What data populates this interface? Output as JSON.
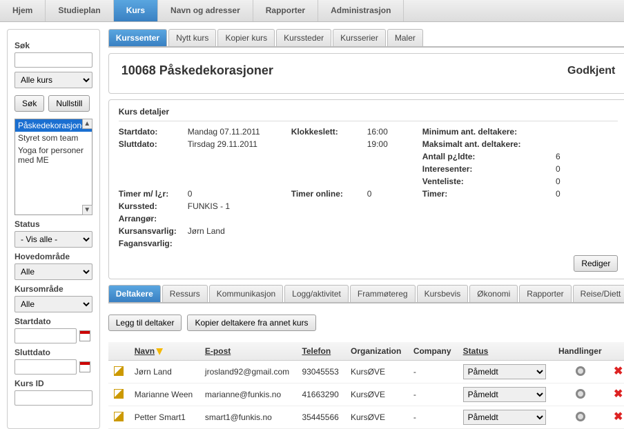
{
  "topnav": {
    "items": [
      {
        "label": "Hjem"
      },
      {
        "label": "Studieplan"
      },
      {
        "label": "Kurs"
      },
      {
        "label": "Navn og adresser"
      },
      {
        "label": "Rapporter"
      },
      {
        "label": "Administrasjon"
      }
    ],
    "active_index": 2
  },
  "sidebar": {
    "search_label": "Søk",
    "search_value": "",
    "scope_select": "Alle kurs",
    "search_btn": "Søk",
    "reset_btn": "Nullstill",
    "courses": [
      {
        "label": "Påskedekorasjoner",
        "selected": true
      },
      {
        "label": "Styret som team",
        "selected": false
      },
      {
        "label": "Yoga for personer med ME",
        "selected": false
      }
    ],
    "status_label": "Status",
    "status_value": "- Vis alle -",
    "main_area_label": "Hovedområde",
    "main_area_value": "Alle",
    "course_area_label": "Kursområde",
    "course_area_value": "Alle",
    "start_date_label": "Startdato",
    "start_date_value": "",
    "end_date_label": "Sluttdato",
    "end_date_value": "",
    "course_id_label": "Kurs ID",
    "course_id_value": ""
  },
  "subtabs_top": {
    "items": [
      {
        "label": "Kurssenter"
      },
      {
        "label": "Nytt kurs"
      },
      {
        "label": "Kopier kurs"
      },
      {
        "label": "Kurssteder"
      },
      {
        "label": "Kursserier"
      },
      {
        "label": "Maler"
      }
    ],
    "active_index": 0
  },
  "header": {
    "title": "10068 Påskedekorasjoner",
    "status": "Godkjent"
  },
  "details": {
    "panel_title": "Kurs detaljer",
    "start_label": "Startdato:",
    "start_value": "Mandag 07.11.2011",
    "end_label": "Sluttdato:",
    "end_value": "Tirsdag 29.11.2011",
    "clock_label": "Klokkeslett:",
    "clock_start": "16:00",
    "clock_end": "19:00",
    "min_label": "Minimum ant. deltakere:",
    "min_value": "",
    "max_label": "Maksimalt ant. deltakere:",
    "max_value": "",
    "enrolled_label": "Antall p¿ldte:",
    "enrolled_value": "6",
    "interested_label": "Interesenter:",
    "interested_value": "0",
    "waitlist_label": "Venteliste:",
    "waitlist_value": "0",
    "hours_teacher_label": "Timer m/ l¿r:",
    "hours_teacher_value": "0",
    "hours_online_label": "Timer online:",
    "hours_online_value": "0",
    "hours_label": "Timer:",
    "hours_value": "0",
    "location_label": "Kurssted:",
    "location_value": "FUNKIS - 1",
    "organizer_label": "Arrangør:",
    "organizer_value": "",
    "responsible_label": "Kursansvarlig:",
    "responsible_value": "Jørn Land",
    "subject_resp_label": "Fagansvarlig:",
    "subject_resp_value": "",
    "edit_btn": "Rediger"
  },
  "subtabs_bottom": {
    "items": [
      {
        "label": "Deltakere"
      },
      {
        "label": "Ressurs"
      },
      {
        "label": "Kommunikasjon"
      },
      {
        "label": "Logg/aktivitet"
      },
      {
        "label": "Frammøtereg"
      },
      {
        "label": "Kursbevis"
      },
      {
        "label": "Økonomi"
      },
      {
        "label": "Rapporter"
      },
      {
        "label": "Reise/Diett"
      }
    ],
    "active_index": 0
  },
  "participants": {
    "add_btn": "Legg til deltaker",
    "copy_btn": "Kopier deltakere fra annet kurs",
    "columns": {
      "name": "Navn",
      "email": "E-post",
      "phone": "Telefon",
      "org": "Organization",
      "company": "Company",
      "status": "Status",
      "actions": "Handlinger"
    },
    "rows": [
      {
        "name": "Jørn Land",
        "email": "jrosland92@gmail.com",
        "phone": "93045553",
        "org": "KursØVE",
        "company": "-",
        "status": "Påmeldt"
      },
      {
        "name": "Marianne Ween",
        "email": "marianne@funkis.no",
        "phone": "41663290",
        "org": "KursØVE",
        "company": "-",
        "status": "Påmeldt"
      },
      {
        "name": "Petter Smart1",
        "email": "smart1@funkis.no",
        "phone": "35445566",
        "org": "KursØVE",
        "company": "-",
        "status": "Påmeldt"
      }
    ]
  }
}
